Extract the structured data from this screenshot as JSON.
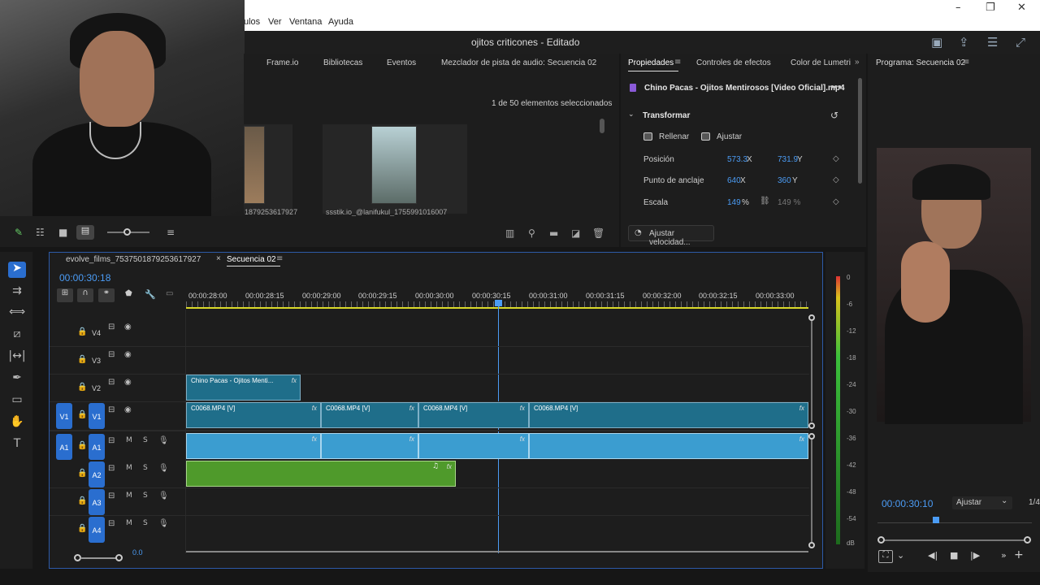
{
  "menubar": {
    "items": [
      "ulos",
      "Ver",
      "Ventana",
      "Ayuda"
    ]
  },
  "title": "ojitos criticones - Editado",
  "project_tabs": [
    "Frame.io",
    "Bibliotecas",
    "Eventos",
    "Mezclador de pista de audio: Secuencia 02"
  ],
  "project": {
    "selection_count": "1 de 50 elementos seleccionados",
    "items": [
      {
        "name": "1879253617927"
      },
      {
        "name": "ssstik.io_@lanifukul_1755991016007"
      }
    ]
  },
  "props_tabs": [
    "Propiedades",
    "Controles de efectos",
    "Color de Lumetri"
  ],
  "props": {
    "clip_name": "Chino Pacas - Ojitos Mentirosos [Video Oficial].mp4",
    "section": "Transformar",
    "fill_label": "Rellenar",
    "fit_label": "Ajustar",
    "position_label": "Posición",
    "position_x": "573.3",
    "position_y": "731.9",
    "anchor_label": "Punto de anclaje",
    "anchor_x": "640",
    "anchor_y": "360",
    "scale_label": "Escala",
    "scale_value": "149",
    "scale_unit": "%",
    "scale_locked": "149 %",
    "x_unit": "X",
    "y_unit": "Y",
    "speed_button": "Ajustar velocidad..."
  },
  "program": {
    "title": "Programa: Secuencia 02",
    "timecode": "00:00:30:10",
    "fit": "Ajustar",
    "zoom_partial": "1/4"
  },
  "timeline": {
    "tabs": [
      "evolve_films_7537501879253617927",
      "Secuencia 02"
    ],
    "timecode": "00:00:30:18",
    "ruler": [
      "00:00:28:00",
      "00:00:28:15",
      "00:00:29:00",
      "00:00:29:15",
      "00:00:30:00",
      "00:00:30:15",
      "00:00:31:00",
      "00:00:31:15",
      "00:00:32:00",
      "00:00:32:15",
      "00:00:33:00"
    ],
    "tracks": {
      "v4": "V4",
      "v3": "V3",
      "v2": "V2",
      "v1": "V1",
      "a1": "A1",
      "a2": "A2",
      "a3": "A3",
      "a4": "A4"
    },
    "mute": "M",
    "solo": "S",
    "v2_clip": "Chino Pacas - Ojitos Menti...",
    "v1_clips": [
      "C0068.MP4 [V]",
      "C0068.MP4 [V]",
      "C0068.MP4 [V]",
      "C0068.MP4 [V]"
    ],
    "fx": "fx",
    "bottom_value": "0.0"
  },
  "meters": {
    "labels": [
      "0",
      "-6",
      "-12",
      "-18",
      "-24",
      "-30",
      "-36",
      "-42",
      "-48",
      "-54",
      "dB"
    ]
  },
  "colors": {
    "accent": "#2a6ecf",
    "clip_video": "#1f6e8a",
    "clip_audio": "#3b9dd0",
    "clip_audio2": "#4f9a2b",
    "playhead": "#4b9cf5"
  }
}
